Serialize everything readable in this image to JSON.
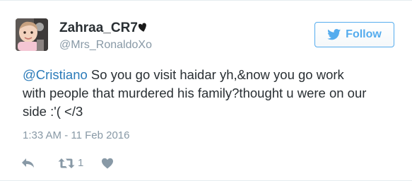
{
  "user": {
    "display_name": "Zahraa_CR7",
    "username": "@Mrs_RonaldoXo",
    "avatar_icon": "baby-photo-avatar"
  },
  "follow_button": {
    "label": "Follow",
    "icon": "twitter-bird-icon"
  },
  "tweet": {
    "mention": "@Cristiano",
    "text_line1": " So you go visit haidar yh,&now you go work",
    "text_line2": "with people that murdered his family?thought u were on our",
    "text_line3": "side :'( </3",
    "timestamp": "1:33 AM - 11 Feb 2016"
  },
  "actions": {
    "reply_icon": "reply-icon",
    "retweet_icon": "retweet-icon",
    "retweet_count": "1",
    "like_icon": "heart-icon"
  },
  "colors": {
    "accent": "#55acee",
    "mention": "#2b7bb9",
    "text": "#292f33",
    "muted": "#8899a6"
  }
}
